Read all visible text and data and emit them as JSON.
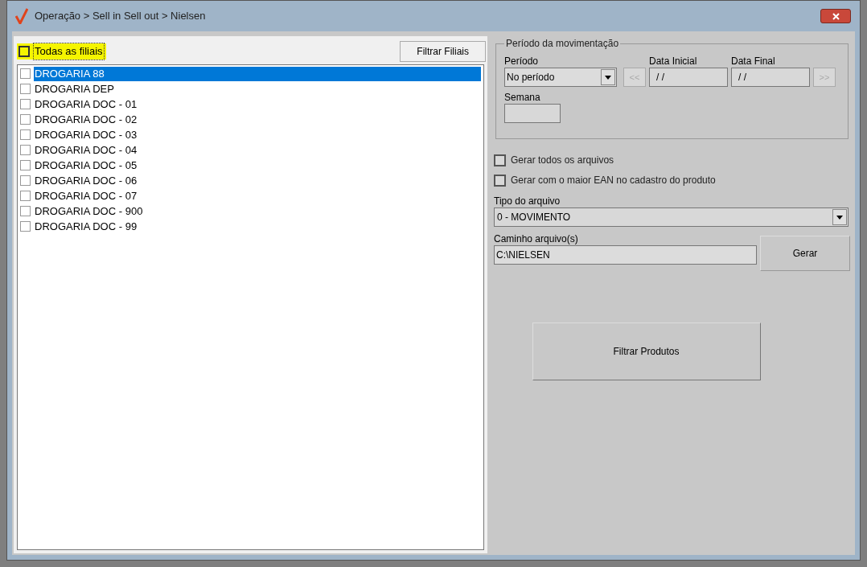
{
  "window": {
    "title": "Operação > Sell in Sell out > Nielsen"
  },
  "branches": {
    "all": {
      "label": "Todas as filiais",
      "checked": false
    },
    "filter_button": "Filtrar Filiais",
    "items": [
      {
        "label": "DROGARIA 88",
        "checked": false,
        "selected": true
      },
      {
        "label": "DROGARIA DEP",
        "checked": false,
        "selected": false
      },
      {
        "label": "DROGARIA DOC - 01",
        "checked": false,
        "selected": false
      },
      {
        "label": "DROGARIA DOC - 02",
        "checked": false,
        "selected": false
      },
      {
        "label": "DROGARIA DOC - 03",
        "checked": false,
        "selected": false
      },
      {
        "label": "DROGARIA DOC - 04",
        "checked": false,
        "selected": false
      },
      {
        "label": "DROGARIA DOC - 05",
        "checked": false,
        "selected": false
      },
      {
        "label": "DROGARIA DOC - 06",
        "checked": false,
        "selected": false
      },
      {
        "label": "DROGARIA DOC - 07",
        "checked": false,
        "selected": false
      },
      {
        "label": "DROGARIA DOC - 900",
        "checked": false,
        "selected": false
      },
      {
        "label": "DROGARIA DOC - 99",
        "checked": false,
        "selected": false
      }
    ]
  },
  "period": {
    "legend": "Período da movimentação",
    "period_label": "Período",
    "period_value": "No período",
    "prev_button": "<<",
    "start_label": "Data Inicial",
    "start_value": "/ /",
    "end_label": "Data Final",
    "end_value": "/ /",
    "next_button": ">>",
    "week_label": "Semana"
  },
  "options": [
    {
      "label": "Gerar todos os arquivos",
      "checked": false
    },
    {
      "label": "Gerar com o maior EAN no cadastro do produto",
      "checked": false
    }
  ],
  "file_type": {
    "label": "Tipo do arquivo",
    "value": "0 - MOVIMENTO"
  },
  "path": {
    "label": "Caminho arquivo(s)",
    "value": "C:\\NIELSEN"
  },
  "generate_button": "Gerar",
  "filter_products_button": "Filtrar Produtos"
}
